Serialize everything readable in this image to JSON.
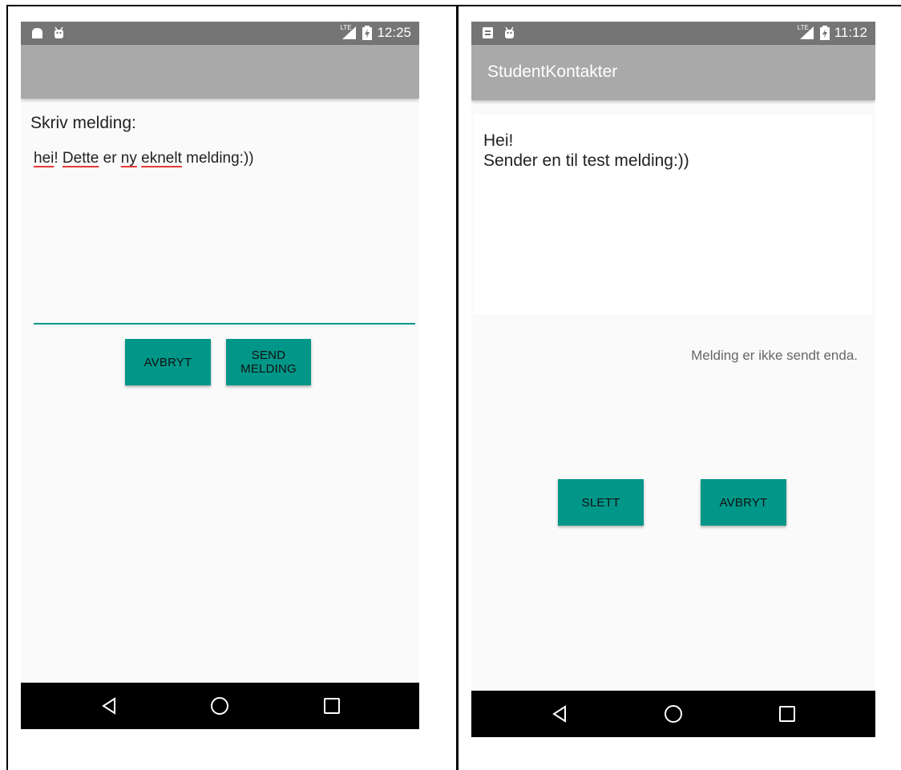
{
  "left_screen": {
    "status_bar": {
      "time": "12:25",
      "network": "LTE",
      "icons": [
        "android-notification-icon",
        "android-debug-icon",
        "signal-icon",
        "battery-charging-icon"
      ]
    },
    "app_bar": {
      "title": ""
    },
    "prompt_label": "Skriv melding:",
    "message_words": [
      {
        "text": "hei",
        "misspelled": true
      },
      {
        "text": "! ",
        "misspelled": false
      },
      {
        "text": "Dette",
        "misspelled": true
      },
      {
        "text": " er ",
        "misspelled": false
      },
      {
        "text": "ny",
        "misspelled": true
      },
      {
        "text": " ",
        "misspelled": false
      },
      {
        "text": "eknelt",
        "misspelled": true
      },
      {
        "text": " melding:))",
        "misspelled": false
      }
    ],
    "cancel_button": "AVBRYT",
    "send_button_line1": "SEND",
    "send_button_line2": "MELDING",
    "nav": [
      "back-icon",
      "home-icon",
      "recents-icon"
    ]
  },
  "right_screen": {
    "status_bar": {
      "time": "11:12",
      "network": "LTE",
      "icons": [
        "sd-card-icon",
        "android-debug-icon",
        "signal-icon",
        "battery-charging-icon"
      ]
    },
    "app_bar": {
      "title": "StudentKontakter"
    },
    "message_line1": "Hei!",
    "message_line2": "Sender en til test melding:))",
    "status_text": "Melding er ikke sendt enda.",
    "delete_button": "SLETT",
    "cancel_button": "AVBRYT",
    "nav": [
      "back-icon",
      "home-icon",
      "recents-icon"
    ]
  },
  "colors": {
    "accent": "#009688",
    "status_bar": "#757575",
    "app_bar": "#a9a9a9",
    "background": "#fafafa",
    "spellcheck_underline": "#e53935"
  }
}
